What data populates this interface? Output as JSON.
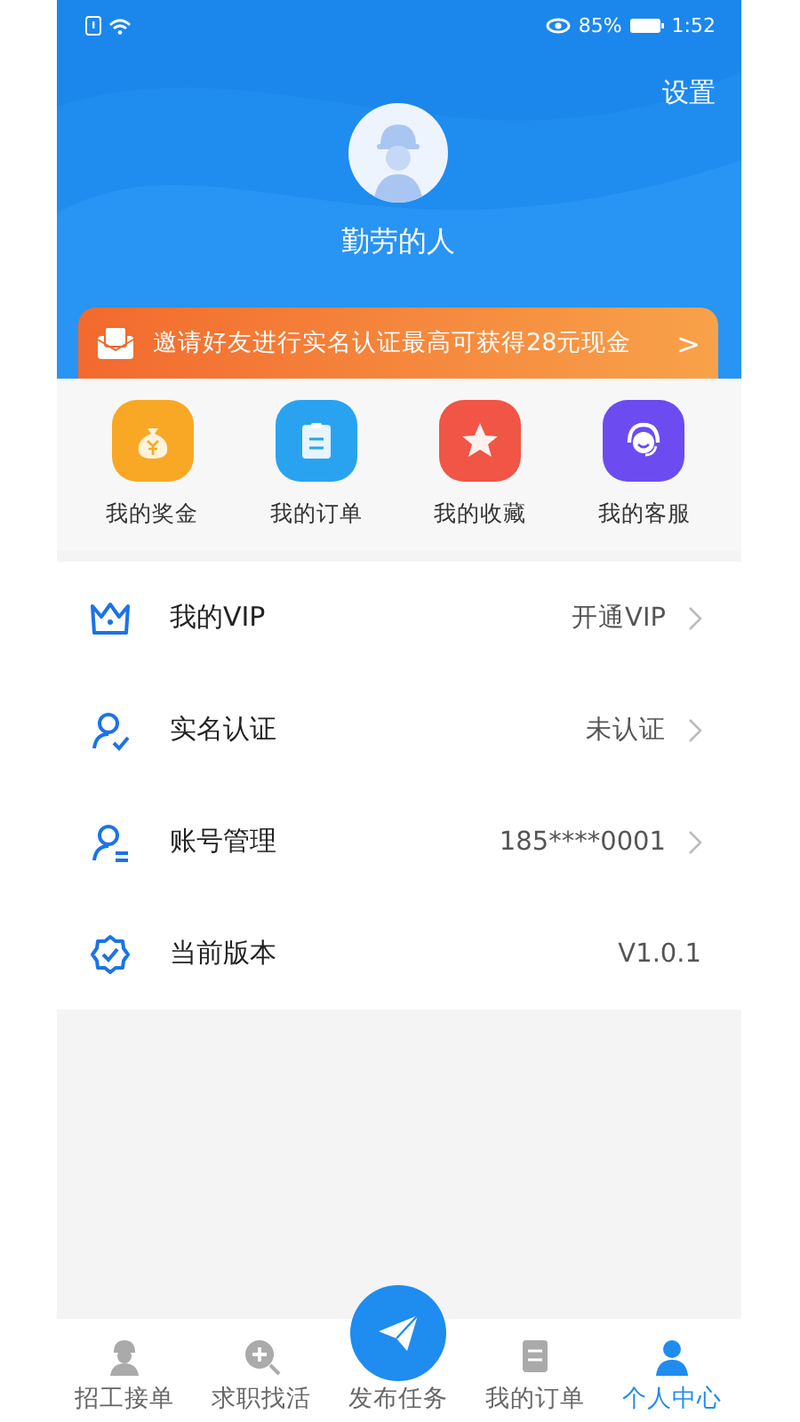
{
  "status_bar": {
    "battery": "85%",
    "time": "1:52"
  },
  "header": {
    "settings": "设置",
    "username": "勤劳的人"
  },
  "banner": {
    "text": "邀请好友进行实名认证最高可获得28元现金",
    "arrow": ">"
  },
  "shortcuts": [
    {
      "label": "我的奖金",
      "kind": "bonus",
      "color": "#f9a825"
    },
    {
      "label": "我的订单",
      "kind": "orders",
      "color": "#29a3f0"
    },
    {
      "label": "我的收藏",
      "kind": "favorites",
      "color": "#f05545"
    },
    {
      "label": "我的客服",
      "kind": "service",
      "color": "#6c4cf0"
    }
  ],
  "menu": [
    {
      "label": "我的VIP",
      "value": "开通VIP",
      "kind": "vip",
      "arrow": true
    },
    {
      "label": "实名认证",
      "value": "未认证",
      "kind": "verify",
      "arrow": true
    },
    {
      "label": "账号管理",
      "value": "185****0001",
      "kind": "account",
      "arrow": true
    },
    {
      "label": "当前版本",
      "value": "V1.0.1",
      "kind": "version",
      "arrow": false
    }
  ],
  "bottom_nav": [
    {
      "label": "招工接单",
      "kind": "worker",
      "selected": false
    },
    {
      "label": "求职找活",
      "kind": "search",
      "selected": false
    },
    {
      "label": "发布任务",
      "kind": "publish",
      "selected": false
    },
    {
      "label": "我的订单",
      "kind": "orders",
      "selected": false
    },
    {
      "label": "个人中心",
      "kind": "me",
      "selected": true
    }
  ]
}
